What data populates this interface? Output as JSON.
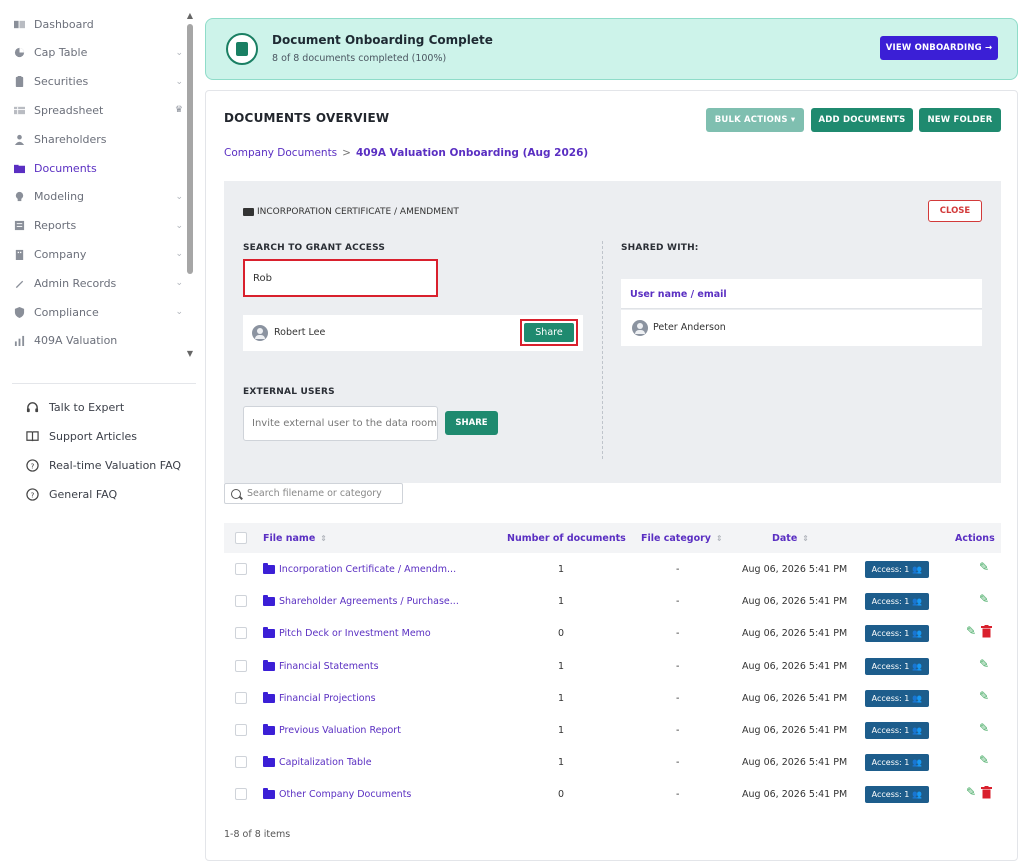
{
  "sidebar": {
    "items": [
      {
        "label": "Dashboard",
        "icon": "dashboard-icon",
        "chevron": false,
        "active": false
      },
      {
        "label": "Cap Table",
        "icon": "pie-chart-icon",
        "chevron": true,
        "active": false
      },
      {
        "label": "Securities",
        "icon": "clipboard-icon",
        "chevron": true,
        "active": false
      },
      {
        "label": "Spreadsheet",
        "icon": "table-icon",
        "chevron": false,
        "active": false,
        "crown": true
      },
      {
        "label": "Shareholders",
        "icon": "person-icon",
        "chevron": false,
        "active": false
      },
      {
        "label": "Documents",
        "icon": "folder-icon",
        "chevron": false,
        "active": true
      },
      {
        "label": "Modeling",
        "icon": "lightbulb-icon",
        "chevron": true,
        "active": false
      },
      {
        "label": "Reports",
        "icon": "report-icon",
        "chevron": true,
        "active": false
      },
      {
        "label": "Company",
        "icon": "building-icon",
        "chevron": true,
        "active": false
      },
      {
        "label": "Admin Records",
        "icon": "records-icon",
        "chevron": true,
        "active": false
      },
      {
        "label": "Compliance",
        "icon": "shield-icon",
        "chevron": true,
        "active": false
      },
      {
        "label": "409A Valuation",
        "icon": "valuation-icon",
        "chevron": false,
        "active": false
      }
    ],
    "help": [
      {
        "label": "Talk to Expert",
        "icon": "headset-icon"
      },
      {
        "label": "Support Articles",
        "icon": "book-icon"
      },
      {
        "label": "Real-time Valuation FAQ",
        "icon": "question-icon"
      },
      {
        "label": "General FAQ",
        "icon": "question-icon"
      }
    ]
  },
  "banner": {
    "title": "Document Onboarding Complete",
    "subtitle": "8 of 8 documents completed (100%)",
    "button": "VIEW ONBOARDING →"
  },
  "main": {
    "title": "DOCUMENTS OVERVIEW",
    "bulk_actions": "BULK ACTIONS ▾",
    "add_documents": "ADD DOCUMENTS",
    "new_folder": "NEW FOLDER",
    "breadcrumb": {
      "root": "Company Documents",
      "sep": ">",
      "current": "409A Valuation Onboarding (Aug 2026)"
    }
  },
  "share_panel": {
    "folder_title": "INCORPORATION CERTIFICATE / AMENDMENT",
    "close": "CLOSE",
    "search_label": "SEARCH TO GRANT ACCESS",
    "search_value": "Rob",
    "result_user": "Robert Lee",
    "share_button": "Share",
    "shared_with_label": "SHARED WITH:",
    "shared_header": "User name / email",
    "shared_user": "Peter Anderson",
    "external_label": "EXTERNAL USERS",
    "external_placeholder": "Invite external user to the data room",
    "external_share": "SHARE"
  },
  "table": {
    "search_placeholder": "Search filename or category",
    "headers": {
      "file_name": "File name",
      "num_docs": "Number of documents",
      "category": "File category",
      "date": "Date",
      "actions": "Actions"
    },
    "rows": [
      {
        "name": "Incorporation Certificate / Amendm...",
        "count": "1",
        "category": "-",
        "date": "Aug 06, 2026 5:41 PM",
        "access": "Access: 1",
        "deletable": false
      },
      {
        "name": "Shareholder Agreements / Purchase...",
        "count": "1",
        "category": "-",
        "date": "Aug 06, 2026 5:41 PM",
        "access": "Access: 1",
        "deletable": false
      },
      {
        "name": "Pitch Deck or Investment Memo",
        "count": "0",
        "category": "-",
        "date": "Aug 06, 2026 5:41 PM",
        "access": "Access: 1",
        "deletable": true
      },
      {
        "name": "Financial Statements",
        "count": "1",
        "category": "-",
        "date": "Aug 06, 2026 5:41 PM",
        "access": "Access: 1",
        "deletable": false
      },
      {
        "name": "Financial Projections",
        "count": "1",
        "category": "-",
        "date": "Aug 06, 2026 5:41 PM",
        "access": "Access: 1",
        "deletable": false
      },
      {
        "name": "Previous Valuation Report",
        "count": "1",
        "category": "-",
        "date": "Aug 06, 2026 5:41 PM",
        "access": "Access: 1",
        "deletable": false
      },
      {
        "name": "Capitalization Table",
        "count": "1",
        "category": "-",
        "date": "Aug 06, 2026 5:41 PM",
        "access": "Access: 1",
        "deletable": false
      },
      {
        "name": "Other Company Documents",
        "count": "0",
        "category": "-",
        "date": "Aug 06, 2026 5:41 PM",
        "access": "Access: 1",
        "deletable": true
      }
    ],
    "footer": "1-8 of 8 items"
  },
  "colors": {
    "accent": "#5a2fc2",
    "primary_green": "#1f8a6f",
    "banner_bg": "#cdf3ea",
    "access_badge": "#1d5d8c",
    "danger": "#d9202d"
  }
}
